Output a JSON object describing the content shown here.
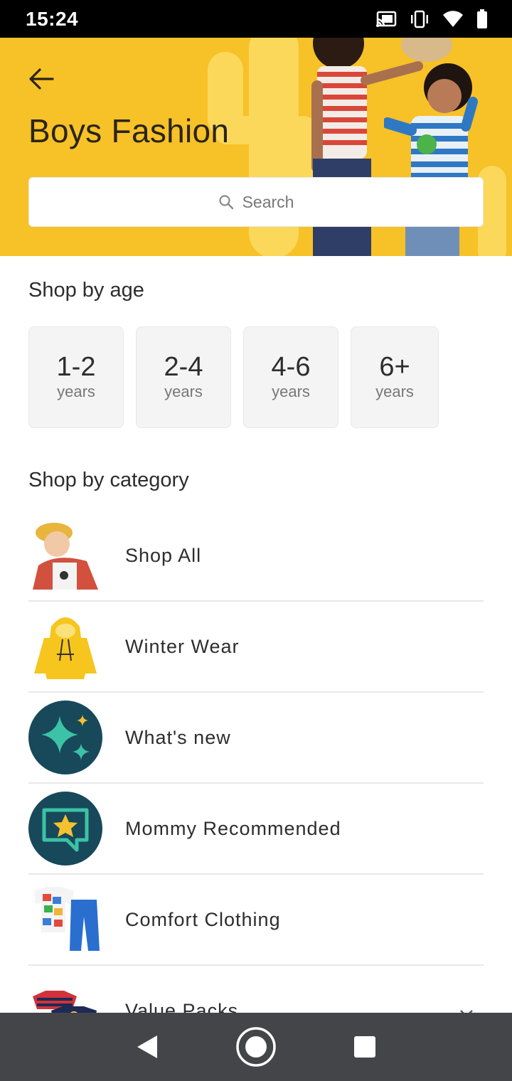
{
  "status_bar": {
    "time": "15:24",
    "icons": [
      "cast-icon",
      "vibrate-icon",
      "wifi-icon",
      "battery-icon"
    ]
  },
  "header": {
    "title": "Boys Fashion",
    "back_icon": "arrow-left-icon",
    "search_placeholder": "Search",
    "search_icon": "search-icon",
    "background_color": "#f7c128"
  },
  "shop_by_age": {
    "title": "Shop by age",
    "items": [
      {
        "range": "1-2",
        "unit": "years"
      },
      {
        "range": "2-4",
        "unit": "years"
      },
      {
        "range": "4-6",
        "unit": "years"
      },
      {
        "range": "6+",
        "unit": "years"
      }
    ]
  },
  "shop_by_category": {
    "title": "Shop by category",
    "items": [
      {
        "label": "Shop All",
        "icon": "boy-photo-thumbnail"
      },
      {
        "label": "Winter Wear",
        "icon": "yellow-hoodie-thumbnail"
      },
      {
        "label": "What's new",
        "icon": "sparkle-icon"
      },
      {
        "label": "Mommy Recommended",
        "icon": "star-chat-icon"
      },
      {
        "label": "Comfort Clothing",
        "icon": "clothing-set-thumbnail"
      },
      {
        "label": "Value Packs",
        "icon": "tshirt-pack-thumbnail"
      }
    ]
  },
  "nav_bar": {
    "buttons": [
      "back-triangle-icon",
      "home-circle-icon",
      "recents-square-icon"
    ]
  },
  "colors": {
    "accent_teal": "#17495a",
    "sparkle_teal": "#3cc2a6",
    "sparkle_yellow": "#f5c12f"
  }
}
